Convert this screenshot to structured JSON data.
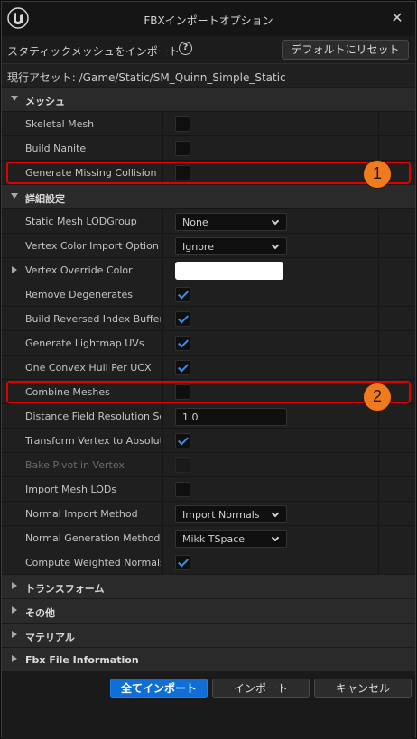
{
  "window": {
    "title": "FBXインポートオプション"
  },
  "topbar": {
    "label": "スタティックメッシュをインポート",
    "reset_label": "デフォルトにリセット"
  },
  "asset": {
    "label": "現行アセット:  /Game/Static/SM_Quinn_Simple_Static"
  },
  "sections": {
    "mesh": "メッシュ",
    "advanced": "詳細設定",
    "transform": "トランスフォーム",
    "misc": "その他",
    "material": "マテリアル",
    "fbx_info": "Fbx File Information"
  },
  "rows": {
    "skeletal_mesh": {
      "label": "Skeletal Mesh",
      "checked": false
    },
    "build_nanite": {
      "label": "Build Nanite",
      "checked": false
    },
    "generate_missing_collision": {
      "label": "Generate Missing Collision",
      "checked": false
    },
    "static_mesh_lod_group": {
      "label": "Static Mesh LODGroup",
      "value": "None"
    },
    "vertex_color_import_option": {
      "label": "Vertex Color Import Option",
      "value": "Ignore"
    },
    "vertex_override_color": {
      "label": "Vertex Override Color",
      "color": "#ffffff"
    },
    "remove_degenerates": {
      "label": "Remove Degenerates",
      "checked": true
    },
    "build_reversed_index_buffer": {
      "label": "Build Reversed Index Buffer",
      "checked": true
    },
    "generate_lightmap_uvs": {
      "label": "Generate Lightmap UVs",
      "checked": true
    },
    "one_convex_hull_per_ucx": {
      "label": "One Convex Hull Per UCX",
      "checked": true
    },
    "combine_meshes": {
      "label": "Combine Meshes",
      "checked": false
    },
    "distance_field_resolution_scale": {
      "label": "Distance Field Resolution Sc...",
      "value": "1.0"
    },
    "transform_vertex_to_absolute": {
      "label": "Transform Vertex to Absolute",
      "checked": true
    },
    "bake_pivot_in_vertex": {
      "label": "Bake Pivot in Vertex",
      "checked": false,
      "disabled": true
    },
    "import_mesh_lods": {
      "label": "Import Mesh LODs",
      "checked": false
    },
    "normal_import_method": {
      "label": "Normal Import Method",
      "value": "Import Normals"
    },
    "normal_generation_method": {
      "label": "Normal Generation Method",
      "value": "Mikk TSpace"
    },
    "compute_weighted_normals": {
      "label": "Compute Weighted Normals",
      "checked": true
    }
  },
  "annotations": {
    "badge1": "1",
    "badge2": "2",
    "highlight_color": "#e00000",
    "badge_color": "#f07a1e"
  },
  "footer": {
    "import_all": "全てインポート",
    "import": "インポート",
    "cancel": "キャンセル"
  },
  "colors": {
    "accent": "#0f6fd6",
    "check": "#3b8fe8"
  }
}
